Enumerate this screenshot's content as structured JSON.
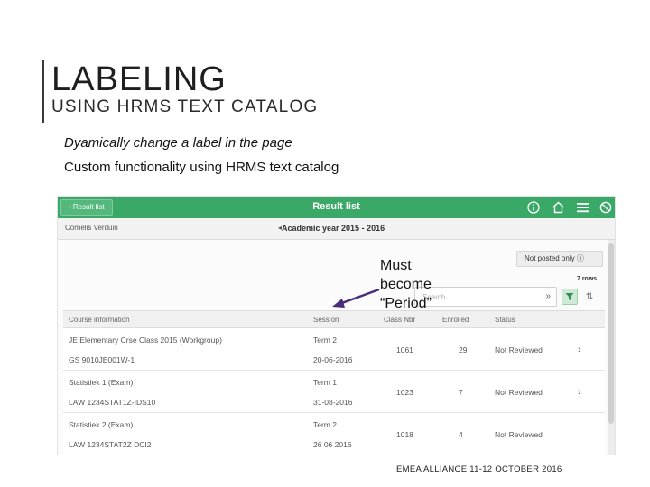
{
  "slide": {
    "title": "LABELING",
    "subtitle": "USING HRMS TEXT CATALOG",
    "note_italic": "Dyamically change a label in the page",
    "note_plain": "Custom functionality using HRMS text catalog",
    "callout_lines": [
      "Must",
      "become",
      "“Period”"
    ],
    "footer": "EMEA ALLIANCE 11-12 OCTOBER 2016"
  },
  "app": {
    "back_label": "Result list",
    "title": "Result list",
    "header_icons": [
      "info-icon",
      "home-icon",
      "menu-icon",
      "block-icon"
    ],
    "person_name": "Cornelis Verduin",
    "academic_year": "Academic year 2015 - 2016",
    "not_posted_label": "Not posted only",
    "rows_count": "7 rows",
    "search_placeholder": "Search",
    "columns": [
      "Course information",
      "Session",
      "Class Nbr",
      "Enrolled",
      "Status"
    ],
    "rows": [
      {
        "course": "JE Elementary Crse Class 2015 (Workgroup)",
        "code": "GS 9010JE001W-1",
        "session": "Term 2",
        "date": "20-06-2016",
        "class_nbr": "1061",
        "enrolled": "29",
        "status": "Not Reviewed"
      },
      {
        "course": "Statistiek 1 (Exam)",
        "code": "LAW 1234STAT1Z-IDS10",
        "session": "Term 1",
        "date": "31-08-2016",
        "class_nbr": "1023",
        "enrolled": "7",
        "status": "Not Reviewed"
      },
      {
        "course": "Statistiek 2 (Exam)",
        "code": "LAW 1234STAT2Z DCI2",
        "session": "Term 2",
        "date": "26 06 2016",
        "class_nbr": "1018",
        "enrolled": "4",
        "status": "Not Reviewed"
      }
    ],
    "colors": {
      "header_green": "#3aa867",
      "callout_arrow": "#4a2d7a"
    }
  }
}
